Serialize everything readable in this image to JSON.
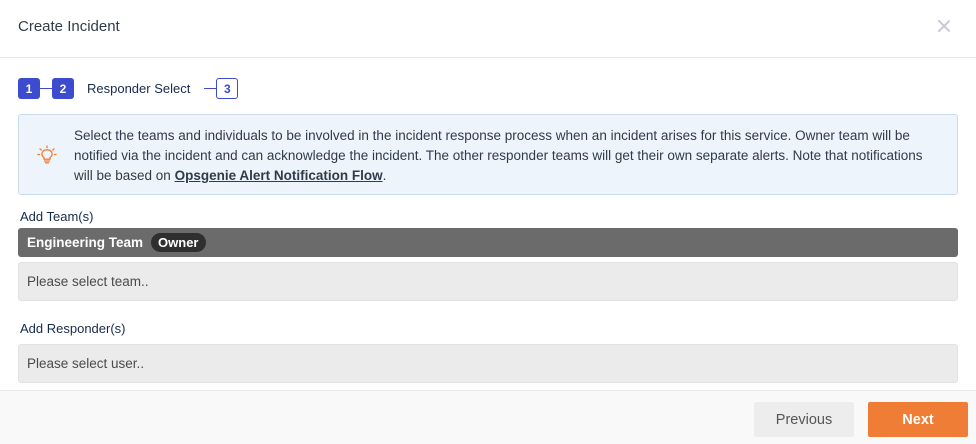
{
  "dialog": {
    "title": "Create Incident"
  },
  "stepper": {
    "step1": "1",
    "step2": "2",
    "current_label": "Responder Select",
    "step3": "3"
  },
  "info": {
    "icon": "lightbulb-icon",
    "text": "Select the teams and individuals to be involved in the incident response process when an incident arises for this service. Owner team will be notified via the incident and can acknowledge the incident. The other responder teams will get their own separate alerts. Note that notifications will be based on ",
    "link_text": "Opsgenie Alert Notification Flow",
    "suffix": "."
  },
  "teams": {
    "label": "Add Team(s)",
    "selected_team": "Engineering Team",
    "owner_badge": "Owner",
    "placeholder": "Please select team.."
  },
  "responders": {
    "label": "Add Responder(s)",
    "placeholder": "Please select user.."
  },
  "footer": {
    "previous_label": "Previous",
    "next_label": "Next"
  },
  "colors": {
    "accent": "#3d4ccf",
    "primary_button": "#f07d35",
    "info_bg": "#eef4fb",
    "chip_bg": "#6b6b6b"
  }
}
